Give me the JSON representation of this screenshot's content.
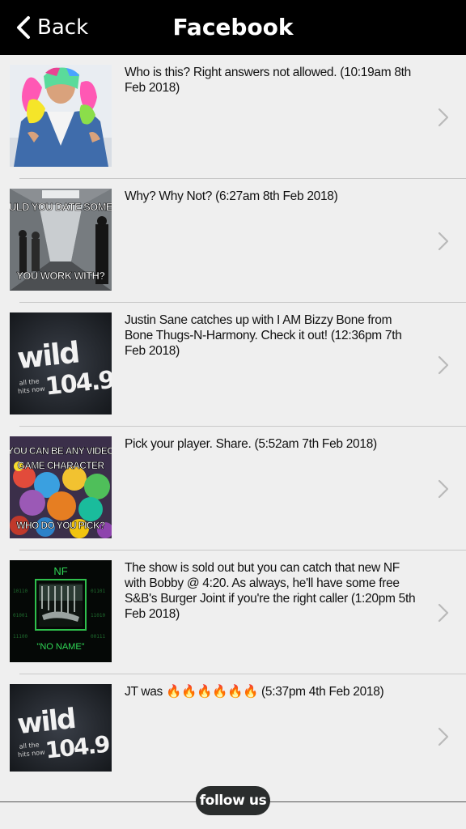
{
  "nav": {
    "back_label": "Back",
    "title": "Facebook"
  },
  "posts": [
    {
      "text": "Who is this? Right answers not allowed. (10:19am 8th Feb 2018)",
      "thumb": "rainbow-haired-person-photo"
    },
    {
      "text": "Why? Why Not? (6:27am 8th Feb 2018)",
      "thumb": "office-hallway-meme",
      "thumb_caption_top": "OULD YOU DATE SOMEO",
      "thumb_caption_bottom": "YOU WORK WITH?"
    },
    {
      "text": "Justin Sane catches up with I AM Bizzy Bone from Bone Thugs-N-Harmony. Check it out! (12:36pm 7th Feb 2018)",
      "thumb": "wild-1049-logo",
      "thumb_logo_word": "wild",
      "thumb_logo_freq": "104.9",
      "thumb_logo_tag1": "all the",
      "thumb_logo_tag2": "hits now"
    },
    {
      "text": "Pick your player. Share. (5:52am 7th Feb 2018)",
      "thumb": "video-game-characters-meme",
      "thumb_caption_top": "YOU CAN BE ANY VIDEO",
      "thumb_caption_mid": "GAME CHARACTER",
      "thumb_caption_bottom": "WHO DO YOU PICK?"
    },
    {
      "text": "The show is sold out but you can catch that new NF with Bobby @ 4:20. As always, he'll have some free S&B's Burger Joint if you're the right caller (1:20pm 5th Feb 2018)",
      "thumb": "nf-no-name-album-cover",
      "thumb_caption_top": "NF",
      "thumb_caption_bottom": "\"NO NAME\""
    },
    {
      "text": "JT was 🔥🔥🔥🔥🔥🔥 (5:37pm 4th Feb 2018)",
      "thumb": "wild-1049-logo",
      "thumb_logo_word": "wild",
      "thumb_logo_freq": "104.9",
      "thumb_logo_tag1": "all the",
      "thumb_logo_tag2": "hits now"
    }
  ],
  "footer": {
    "follow_label": "follow us"
  },
  "icons": {
    "back": "chevron-left-icon",
    "row": "chevron-right-icon"
  },
  "colors": {
    "navbar": "#000000",
    "background": "#efefef",
    "chevron": "#b9b9b9",
    "follow_button": "#2a2d2d"
  }
}
